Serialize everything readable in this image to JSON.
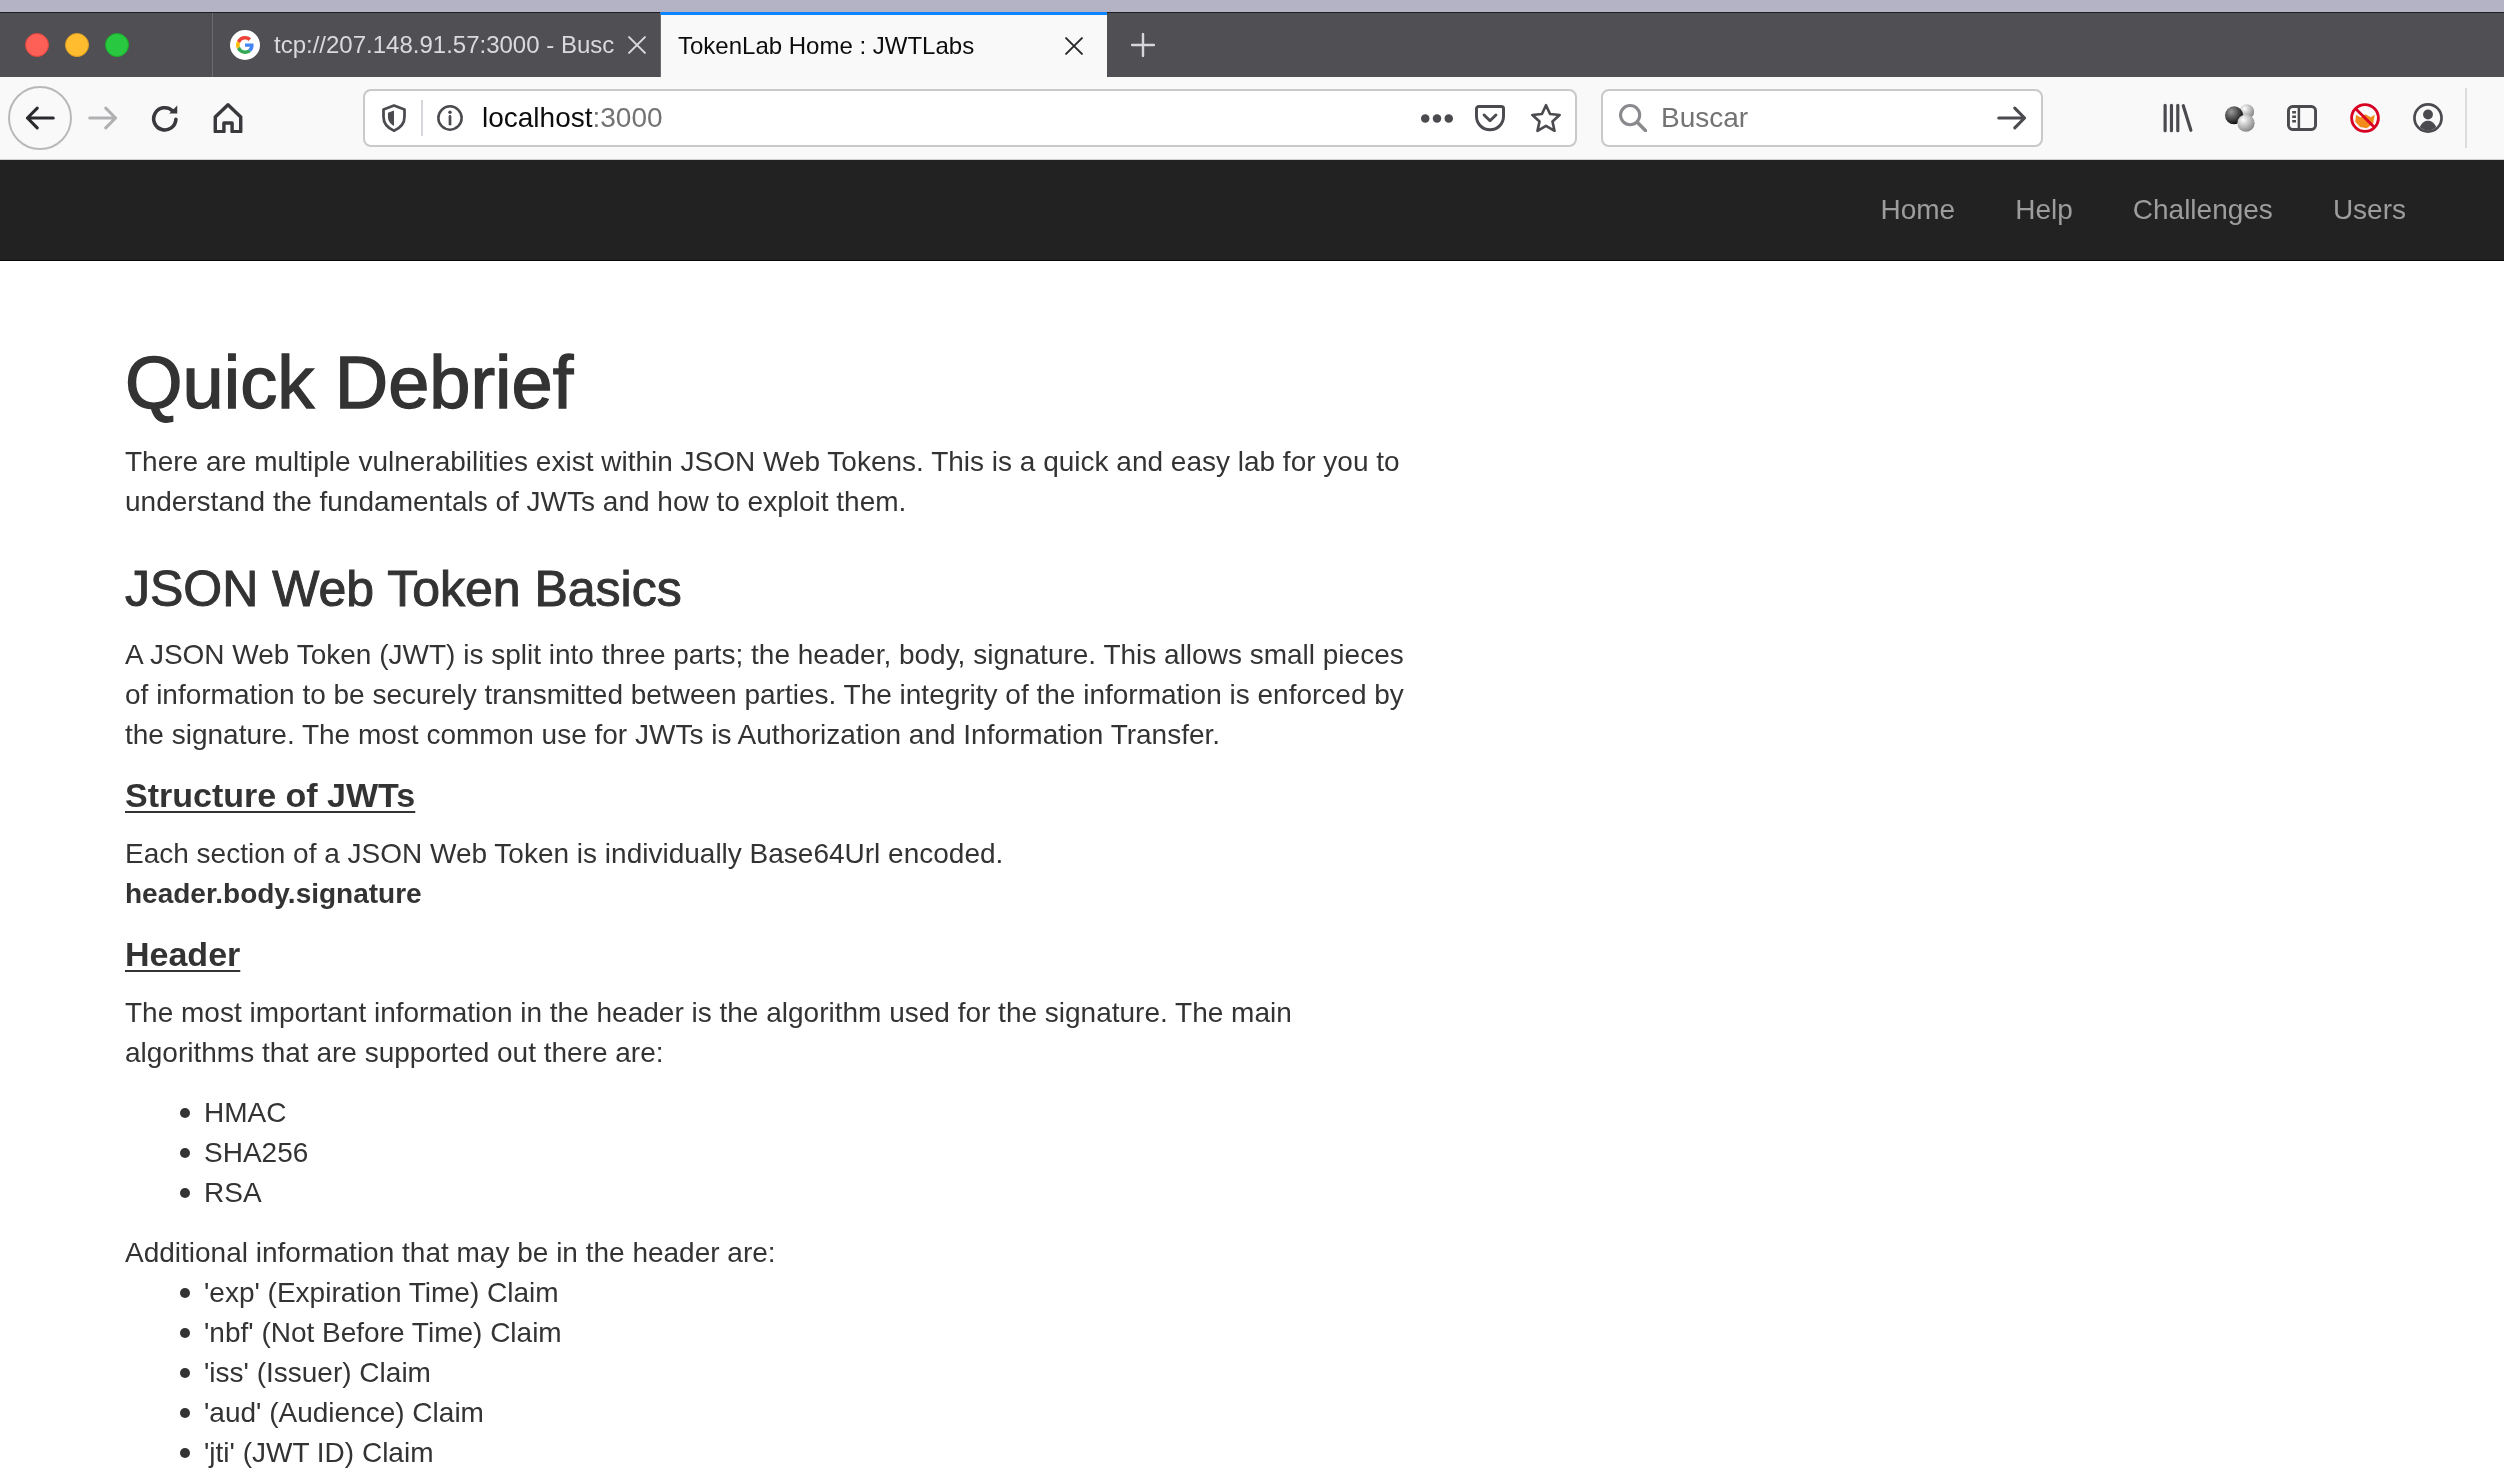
{
  "tabs": [
    {
      "title": "tcp://207.148.91.57:3000 - Busc",
      "favicon": true,
      "selected": false
    },
    {
      "title": "TokenLab Home : JWTLabs",
      "favicon": false,
      "selected": true
    }
  ],
  "address_bar": {
    "host": "localhost",
    "port": ":3000"
  },
  "search": {
    "placeholder": "Buscar"
  },
  "navbar": {
    "links": [
      "Home",
      "Help",
      "Challenges",
      "Users"
    ]
  },
  "content": [
    {
      "kind": "title",
      "text": "Quick Debrief"
    },
    {
      "kind": "paragraph",
      "text": "There are multiple vulnerabilities exist within JSON Web Tokens. This is a quick and easy lab for you to understand the fundamentals of JWTs and how to exploit them."
    },
    {
      "kind": "heading",
      "text": "JSON Web Token Basics"
    },
    {
      "kind": "paragraph",
      "text": "A JSON Web Token (JWT) is split into three parts; the header, body, signature. This allows small pieces of information to be securely transmitted between parties. The integrity of the information is enforced by the signature. The most common use for JWTs is Authorization and Information Transfer."
    },
    {
      "kind": "subheading",
      "text": "Structure of JWTs"
    },
    {
      "kind": "line",
      "text": "Each section of a JSON Web Token is individually Base64Url encoded."
    },
    {
      "kind": "strong",
      "text": "header.body.signature"
    },
    {
      "kind": "subheading",
      "text": "Header"
    },
    {
      "kind": "paragraph",
      "text": "The most important information in the header is the algorithm used for the signature. The main algorithms that are supported out there are:"
    },
    {
      "kind": "list",
      "items": [
        "HMAC",
        "SHA256",
        "RSA"
      ]
    },
    {
      "kind": "line",
      "text": "Additional information that may be in the header are:"
    },
    {
      "kind": "list",
      "items": [
        "'exp' (Expiration Time) Claim",
        "'nbf' (Not Before Time) Claim",
        "'iss' (Issuer) Claim",
        "'aud' (Audience) Claim",
        "'jti' (JWT ID) Claim"
      ]
    }
  ]
}
